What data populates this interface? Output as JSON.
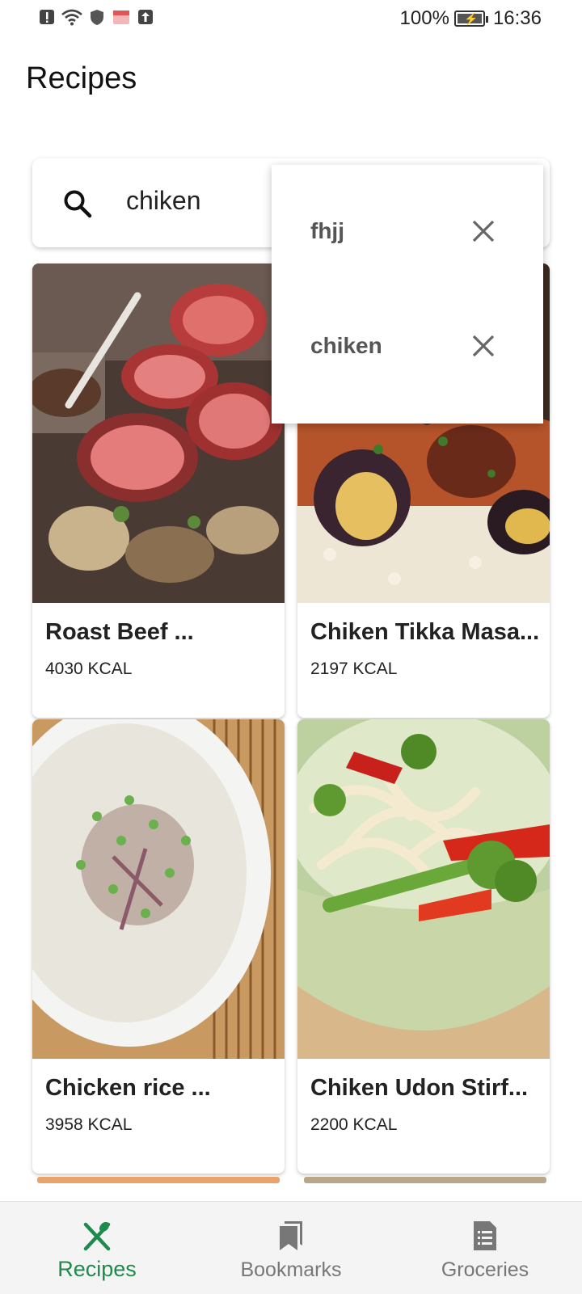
{
  "status_bar": {
    "battery": "100%",
    "time": "16:36"
  },
  "page_title": "Recipes",
  "search": {
    "value": "chiken"
  },
  "suggestions": [
    {
      "label": "fhjj"
    },
    {
      "label": "chiken"
    }
  ],
  "recipes": [
    {
      "name": "Roast Beef ...",
      "kcal": "4030 KCAL"
    },
    {
      "name": "Chiken Tikka Masa...",
      "kcal": "2197 KCAL"
    },
    {
      "name": "Chicken rice ...",
      "kcal": "3958 KCAL"
    },
    {
      "name": "Chiken Udon Stirf...",
      "kcal": "2200 KCAL"
    }
  ],
  "nav": [
    {
      "label": "Recipes",
      "icon": "fork-knife-icon",
      "active": true
    },
    {
      "label": "Bookmarks",
      "icon": "bookmarks-icon",
      "active": false
    },
    {
      "label": "Groceries",
      "icon": "list-icon",
      "active": false
    }
  ],
  "colors": {
    "accent": "#1e8a4c",
    "inactive": "#777777"
  }
}
